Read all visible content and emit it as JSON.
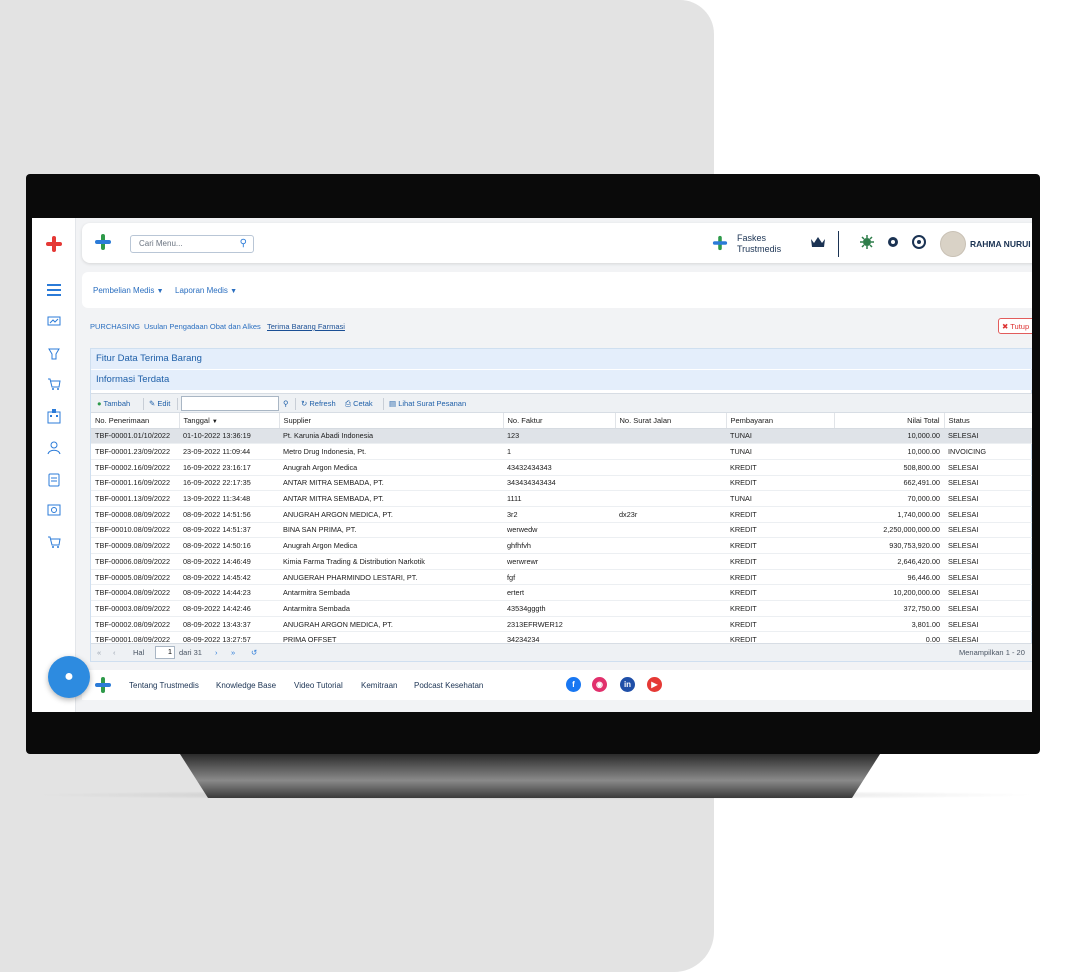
{
  "header": {
    "search_placeholder": "Cari Menu...",
    "faskes_line1": "Faskes",
    "faskes_line2": "Trustmedis",
    "user_name": "RAHMA NURUI"
  },
  "menu": {
    "items": [
      {
        "label": "Pembelian Medis"
      },
      {
        "label": "Laporan Medis"
      }
    ]
  },
  "breadcrumb": {
    "items": [
      "PURCHASING",
      "Usulan Pengadaan Obat dan Alkes",
      "Terima Barang Farmasi"
    ],
    "close_label": "Tutup"
  },
  "panel": {
    "title": "Fitur Data Terima Barang",
    "subtitle": "Informasi Terdata"
  },
  "toolbar": {
    "add": "Tambah",
    "edit": "Edit",
    "refresh": "Refresh",
    "print": "Cetak",
    "view_order": "Lihat Surat Pesanan"
  },
  "table": {
    "columns": [
      "No. Penerimaan",
      "Tanggal",
      "Supplier",
      "No. Faktur",
      "No. Surat Jalan",
      "Pembayaran",
      "Nilai Total",
      "Status"
    ],
    "rows": [
      [
        "TBF-00001.01/10/2022",
        "01-10-2022 13:36:19",
        "Pt. Karunia Abadi Indonesia",
        "123",
        "",
        "TUNAI",
        "10,000.00",
        "SELESAI"
      ],
      [
        "TBF-00001.23/09/2022",
        "23-09-2022 11:09:44",
        "Metro Drug Indonesia, Pt.",
        "1",
        "",
        "TUNAI",
        "10,000.00",
        "INVOICING"
      ],
      [
        "TBF-00002.16/09/2022",
        "16-09-2022 23:16:17",
        "Anugrah Argon Medica",
        "43432434343",
        "",
        "KREDIT",
        "508,800.00",
        "SELESAI"
      ],
      [
        "TBF-00001.16/09/2022",
        "16-09-2022 22:17:35",
        "ANTAR MITRA SEMBADA, PT.",
        "343434343434",
        "",
        "KREDIT",
        "662,491.00",
        "SELESAI"
      ],
      [
        "TBF-00001.13/09/2022",
        "13-09-2022 11:34:48",
        "ANTAR MITRA SEMBADA, PT.",
        "1111",
        "",
        "TUNAI",
        "70,000.00",
        "SELESAI"
      ],
      [
        "TBF-00008.08/09/2022",
        "08-09-2022 14:51:56",
        "ANUGRAH ARGON MEDICA, PT.",
        "3r2",
        "dx23r",
        "KREDIT",
        "1,740,000.00",
        "SELESAI"
      ],
      [
        "TBF-00010.08/09/2022",
        "08-09-2022 14:51:37",
        "BINA SAN PRIMA, PT.",
        "werwedw",
        "",
        "KREDIT",
        "2,250,000,000.00",
        "SELESAI"
      ],
      [
        "TBF-00009.08/09/2022",
        "08-09-2022 14:50:16",
        "Anugrah Argon Medica",
        "ghfhfvh",
        "",
        "KREDIT",
        "930,753,920.00",
        "SELESAI"
      ],
      [
        "TBF-00006.08/09/2022",
        "08-09-2022 14:46:49",
        "Kimia Farma Trading & Distribution Narkotik",
        "werwrewr",
        "",
        "KREDIT",
        "2,646,420.00",
        "SELESAI"
      ],
      [
        "TBF-00005.08/09/2022",
        "08-09-2022 14:45:42",
        "ANUGERAH PHARMINDO LESTARI, PT.",
        "fgf",
        "",
        "KREDIT",
        "96,446.00",
        "SELESAI"
      ],
      [
        "TBF-00004.08/09/2022",
        "08-09-2022 14:44:23",
        "Antarmitra Sembada",
        "ertert",
        "",
        "KREDIT",
        "10,200,000.00",
        "SELESAI"
      ],
      [
        "TBF-00003.08/09/2022",
        "08-09-2022 14:42:46",
        "Antarmitra Sembada",
        "43534gggth",
        "",
        "KREDIT",
        "372,750.00",
        "SELESAI"
      ],
      [
        "TBF-00002.08/09/2022",
        "08-09-2022 13:43:37",
        "ANUGRAH ARGON MEDICA, PT.",
        "2313EFRWER12",
        "",
        "KREDIT",
        "3,801.00",
        "SELESAI"
      ],
      [
        "TBF-00001.08/09/2022",
        "08-09-2022 13:27:57",
        "PRIMA OFFSET",
        "34234234",
        "",
        "KREDIT",
        "0.00",
        "SELESAI"
      ]
    ]
  },
  "pager": {
    "page_label": "Hal",
    "page_value": "1",
    "of_label": "dari 31",
    "showing": "Menampilkan 1 - 20"
  },
  "footer": {
    "links": [
      "Tentang Trustmedis",
      "Knowledge Base",
      "Video Tutorial",
      "Kemitraan",
      "Podcast Kesehatan"
    ]
  },
  "colors": {
    "brand_blue": "#2b7bd8",
    "accent_red": "#e53935",
    "accent_green": "#2e9a4a"
  }
}
